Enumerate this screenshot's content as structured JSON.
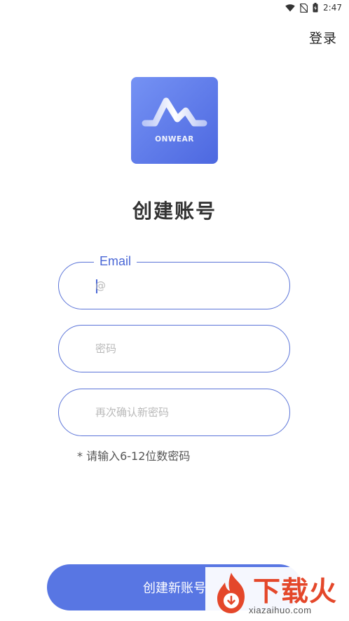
{
  "status_bar": {
    "time": "2:47",
    "icons": [
      "wifi-icon",
      "no-sim-icon",
      "battery-charging-icon"
    ]
  },
  "header": {
    "login_label": "登录"
  },
  "logo": {
    "text": "ONWEAR"
  },
  "page_title": "创建账号",
  "form": {
    "email": {
      "label": "Email",
      "placeholder": "@",
      "value": ""
    },
    "password": {
      "placeholder": "密码",
      "value": ""
    },
    "confirm_password": {
      "placeholder": "再次确认新密码",
      "value": ""
    },
    "hint": "* 请输入6-12位数密码",
    "submit_label": "创建新账号"
  },
  "watermark": {
    "brand": "下载火",
    "url": "xiazaihuo.com"
  },
  "colors": {
    "accent": "#5876e3",
    "border": "#5b74d8",
    "logo_gradient_start": "#7592f4",
    "logo_gradient_end": "#4d68e0",
    "watermark_red": "#e4472a"
  }
}
